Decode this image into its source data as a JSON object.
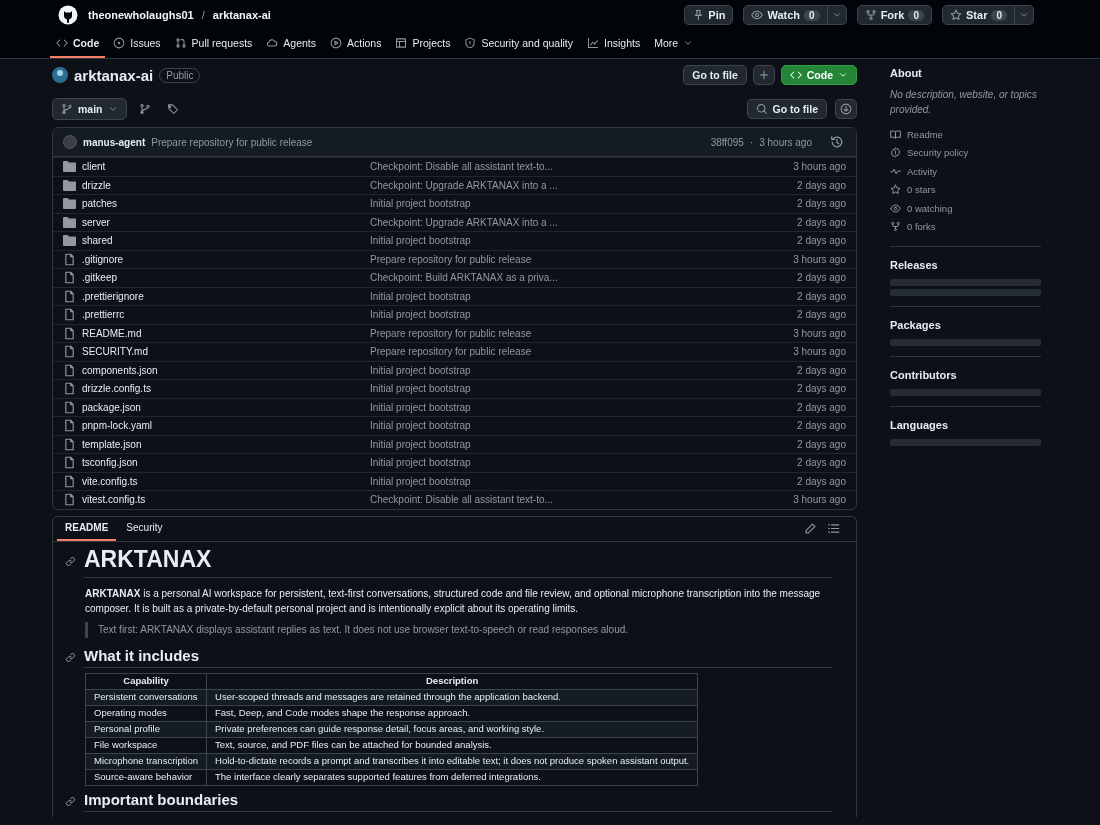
{
  "header": {
    "owner": "theonewholaughs01",
    "separator": "/",
    "repo": "arktanax-ai",
    "actions": [
      {
        "label": "Pin",
        "menu": false
      },
      {
        "label": "Watch",
        "count": "0",
        "menu": true
      },
      {
        "label": "Fork",
        "count": "0",
        "menu": false
      },
      {
        "label": "Star",
        "count": "0",
        "menu": true
      }
    ]
  },
  "nav_tabs": [
    {
      "label": "Code",
      "selected": true
    },
    {
      "label": "Issues",
      "selected": false
    },
    {
      "label": "Pull requests",
      "selected": false
    },
    {
      "label": "Agents",
      "selected": false
    },
    {
      "label": "Actions",
      "selected": false
    },
    {
      "label": "Projects",
      "selected": false
    },
    {
      "label": "Security and quality",
      "selected": false
    },
    {
      "label": "Insights",
      "selected": false
    },
    {
      "label": "More",
      "selected": false
    }
  ],
  "repo": {
    "name": "arktanax-ai",
    "visibility": "Public",
    "go_to_file": "Go to file",
    "code_button": "Code"
  },
  "branch": {
    "name": "main",
    "search": "Go to file"
  },
  "latest_commit": {
    "author": "manus-agent",
    "message": "Prepare repository for public release",
    "sha": "38ff095",
    "separator": "·",
    "time": "3 hours ago"
  },
  "files": [
    {
      "kind": "dir",
      "name": "client",
      "message": "Checkpoint: Disable all assistant text-to...",
      "time": "3 hours ago"
    },
    {
      "kind": "dir",
      "name": "drizzle",
      "message": "Checkpoint: Upgrade ARKTANAX into a ...",
      "time": "2 days ago"
    },
    {
      "kind": "dir",
      "name": "patches",
      "message": "Initial project bootstrap",
      "time": "2 days ago"
    },
    {
      "kind": "dir",
      "name": "server",
      "message": "Checkpoint: Upgrade ARKTANAX into a ...",
      "time": "2 days ago"
    },
    {
      "kind": "dir",
      "name": "shared",
      "message": "Initial project bootstrap",
      "time": "2 days ago"
    },
    {
      "kind": "file",
      "name": ".gitignore",
      "message": "Prepare repository for public release",
      "time": "3 hours ago"
    },
    {
      "kind": "file",
      "name": ".gitkeep",
      "message": "Checkpoint: Build ARKTANAX as a priva...",
      "time": "2 days ago"
    },
    {
      "kind": "file",
      "name": ".prettierignore",
      "message": "Initial project bootstrap",
      "time": "2 days ago"
    },
    {
      "kind": "file",
      "name": ".prettierrc",
      "message": "Initial project bootstrap",
      "time": "2 days ago"
    },
    {
      "kind": "file",
      "name": "README.md",
      "message": "Prepare repository for public release",
      "time": "3 hours ago"
    },
    {
      "kind": "file",
      "name": "SECURITY.md",
      "message": "Prepare repository for public release",
      "time": "3 hours ago"
    },
    {
      "kind": "file",
      "name": "components.json",
      "message": "Initial project bootstrap",
      "time": "2 days ago"
    },
    {
      "kind": "file",
      "name": "drizzle.config.ts",
      "message": "Initial project bootstrap",
      "time": "2 days ago"
    },
    {
      "kind": "file",
      "name": "package.json",
      "message": "Initial project bootstrap",
      "time": "2 days ago"
    },
    {
      "kind": "file",
      "name": "pnpm-lock.yaml",
      "message": "Initial project bootstrap",
      "time": "2 days ago"
    },
    {
      "kind": "file",
      "name": "template.json",
      "message": "Initial project bootstrap",
      "time": "2 days ago"
    },
    {
      "kind": "file",
      "name": "tsconfig.json",
      "message": "Initial project bootstrap",
      "time": "2 days ago"
    },
    {
      "kind": "file",
      "name": "vite.config.ts",
      "message": "Initial project bootstrap",
      "time": "2 days ago"
    },
    {
      "kind": "file",
      "name": "vitest.config.ts",
      "message": "Checkpoint: Disable all assistant text-to...",
      "time": "3 hours ago"
    }
  ],
  "readme": {
    "tabs": [
      {
        "label": "README",
        "selected": true
      },
      {
        "label": "Security",
        "selected": false
      }
    ],
    "title": "ARKTANAX",
    "intro": "**ARKTANAX** is a personal AI workspace for persistent, text-first conversations, structured code and file review, and optional microphone transcription into the message composer. It is built as a private-by-default personal project and is intentionally explicit about its operating limits.",
    "note": "Text first: ARKTANAX displays assistant replies as text. It does not use browser text-to-speech or read responses aloud.",
    "section_heading": "What it includes",
    "table": {
      "columns": [
        "Capability",
        "Description"
      ],
      "rows": [
        [
          "Persistent conversations",
          "User-scoped threads and messages are retained through the application backend."
        ],
        [
          "Operating modes",
          "Fast, Deep, and Code modes shape the response approach."
        ],
        [
          "Personal profile",
          "Private preferences can guide response detail, focus areas, and working style."
        ],
        [
          "File workspace",
          "Text, source, and PDF files can be attached for bounded analysis."
        ],
        [
          "Microphone transcription",
          "Hold-to-dictate records a prompt and transcribes it into editable text; it does not produce spoken assistant output."
        ],
        [
          "Source-aware behavior",
          "The interface clearly separates supported features from deferred integrations."
        ]
      ]
    },
    "next_heading": "Important boundaries"
  },
  "sidebar": {
    "about": {
      "title": "About",
      "description": "No description, website, or topics provided.",
      "links": [
        "Readme",
        "Security policy",
        "Activity",
        "0 stars",
        "0 watching",
        "0 forks"
      ]
    },
    "sections": [
      {
        "title": "Releases",
        "loading": true
      },
      {
        "title": "Packages",
        "loading": true
      },
      {
        "title": "Contributors",
        "loading": true
      },
      {
        "title": "Languages",
        "loading": true
      }
    ]
  }
}
